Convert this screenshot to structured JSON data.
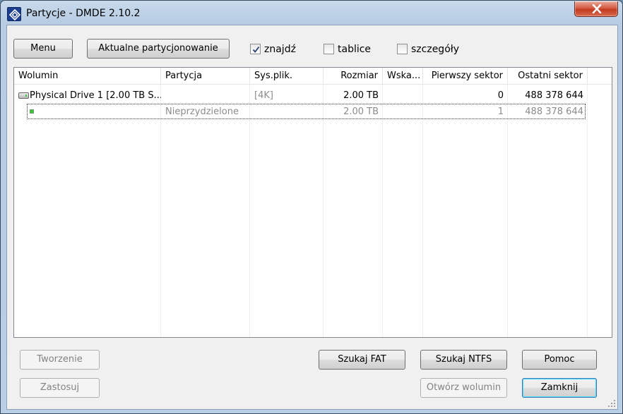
{
  "window": {
    "title": "Partycje - DMDE 2.10.2"
  },
  "toolbar": {
    "menu_label": "Menu",
    "current_partitioning_label": "Aktualne partycjonowanie",
    "checkboxes": [
      {
        "label": "znajdź",
        "checked": true
      },
      {
        "label": "tablice",
        "checked": false
      },
      {
        "label": "szczegóły",
        "checked": false
      }
    ]
  },
  "table": {
    "columns": [
      "Wolumin",
      "Partycja",
      "Sys.plik.",
      "Rozmiar",
      "Wska...",
      "Pierwszy sektor",
      "Ostatni sektor"
    ],
    "rows": [
      {
        "volume": "Physical Drive 1 [2.00 TB S...",
        "partition": "",
        "fs": "[4K]",
        "size": "2.00 TB",
        "flag": "",
        "first": "0",
        "last": "488 378 644",
        "icon": "hard-drive-icon"
      },
      {
        "volume": "",
        "partition": "Nieprzydzielone",
        "fs": "",
        "size": "2.00 TB",
        "flag": "",
        "first": "1",
        "last": "488 378 644",
        "icon": "partition-icon"
      }
    ]
  },
  "buttons": {
    "create": "Tworzenie",
    "apply": "Zastosuj",
    "search_fat": "Szukaj FAT",
    "search_ntfs": "Szukaj NTFS",
    "help": "Pomoc",
    "open_volume": "Otwórz wolumin",
    "close": "Zamknij"
  },
  "colors": {
    "title_bar": "#b9cfe5",
    "close_button": "#c23a20",
    "client_bg": "#f0f0f0"
  }
}
